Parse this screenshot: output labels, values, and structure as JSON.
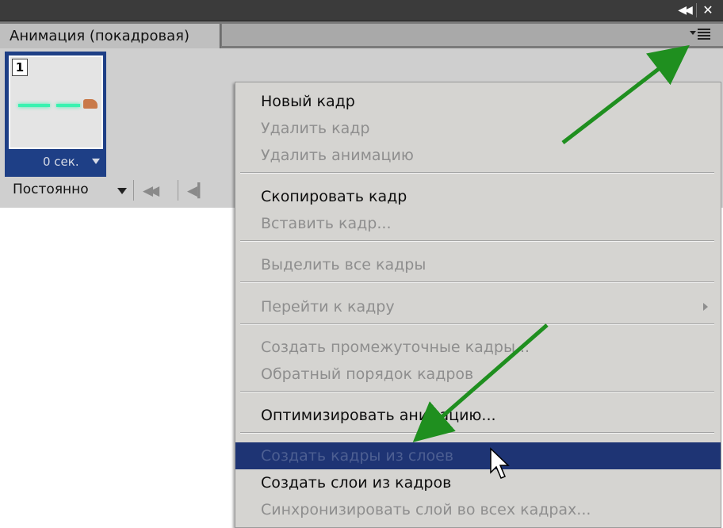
{
  "panel": {
    "tab_title": "Анимация (покадровая)",
    "frame": {
      "number": "1",
      "delay": "0 сек."
    },
    "loop_option": "Постоянно"
  },
  "menu": {
    "items": [
      {
        "label": "Новый кадр",
        "enabled": true
      },
      {
        "label": "Удалить кадр",
        "enabled": false
      },
      {
        "label": "Удалить анимацию",
        "enabled": false
      },
      {
        "label": "Скопировать кадр",
        "enabled": true
      },
      {
        "label": "Вставить кадр...",
        "enabled": false
      },
      {
        "label": "Выделить все кадры",
        "enabled": false
      },
      {
        "label": "Перейти к кадру",
        "enabled": false,
        "submenu": true
      },
      {
        "label": "Создать промежуточные кадры...",
        "enabled": false
      },
      {
        "label": "Обратный порядок кадров",
        "enabled": false
      },
      {
        "label": "Оптимизировать анимацию...",
        "enabled": true
      },
      {
        "label": "Создать кадры из слоев",
        "enabled": false,
        "highlighted": true
      },
      {
        "label": "Создать слои из кадров",
        "enabled": true
      },
      {
        "label": "Синхронизировать слой во всех кадрах...",
        "enabled": false
      }
    ]
  },
  "colors": {
    "highlight": "#1e3474",
    "frame_selected": "#1e3f86",
    "annotation_arrow": "#1f8f1f"
  },
  "icons": [
    "collapse-panels-icon",
    "close-icon",
    "panel-menu-icon",
    "first-frame-icon",
    "previous-frame-icon",
    "submenu-arrow-icon",
    "mouse-cursor-icon"
  ]
}
